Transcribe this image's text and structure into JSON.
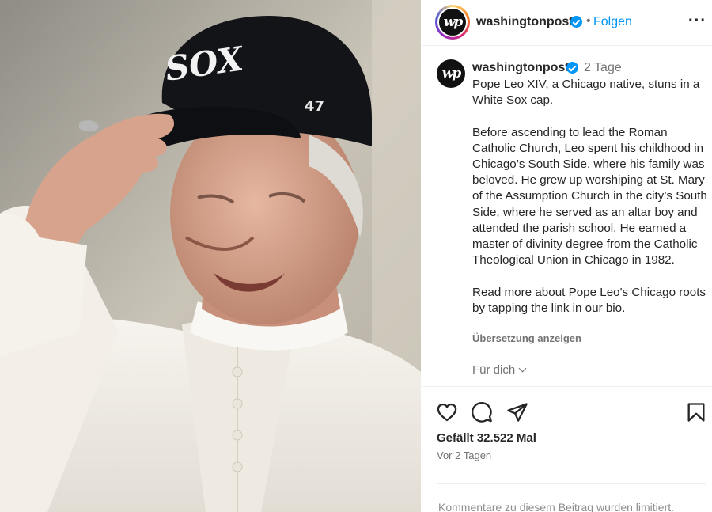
{
  "photo": {
    "subject_icon": "photo-pope-in-white-sox-cap",
    "cap_logo_text": "SOX",
    "cap_side_text": "47"
  },
  "header": {
    "avatar_text": "wp",
    "username": "washingtonpost",
    "separator": "•",
    "follow_label": "Folgen",
    "more_label": "···"
  },
  "caption": {
    "avatar_text": "wp",
    "username": "washingtonpost",
    "time": "2 Tage",
    "paragraphs": [
      "Pope Leo XIV, a Chicago native, stuns in a White Sox cap.",
      "Before ascending to lead the Roman Catholic Church, Leo spent his childhood in Chicago’s South Side, where his family was beloved. He grew up worshiping at St. Mary of the Assumption Church in the city’s South Side, where he served as an altar boy and attended the parish school. He earned a master of divinity degree from the Catholic Theological Union in Chicago in 1982.",
      "Read more about Pope Leo's Chicago roots by tapping the link in our bio."
    ],
    "translate_label": "Übersetzung anzeigen",
    "for_you_label": "Für dich"
  },
  "actions": {
    "icons": [
      "heart-icon",
      "comment-icon",
      "share-icon",
      "bookmark-icon"
    ],
    "likes": "Gefällt 32.522 Mal",
    "ago": "Vor 2 Tagen"
  },
  "footer": {
    "comments_notice": "Kommentare zu diesem Beitrag wurden limitiert."
  },
  "colors": {
    "accent": "#0095f6",
    "text": "#262626",
    "muted": "#737373",
    "divider": "#efefef"
  }
}
